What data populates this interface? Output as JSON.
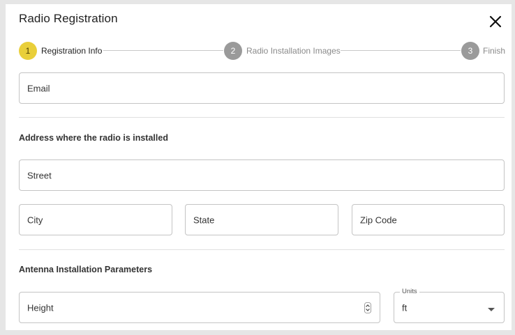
{
  "dialog": {
    "title": "Radio Registration",
    "close_icon": "close-icon"
  },
  "stepper": {
    "steps": [
      {
        "number": "1",
        "label": "Registration Info",
        "state": "active"
      },
      {
        "number": "2",
        "label": "Radio Installation Images",
        "state": "inactive"
      },
      {
        "number": "3",
        "label": "Finish",
        "state": "inactive"
      }
    ],
    "active_color": "#e9cf3a",
    "inactive_color": "#9a9a9a"
  },
  "form": {
    "email_placeholder": "Email",
    "address_section_title": "Address where the radio is installed",
    "street_placeholder": "Street",
    "city_placeholder": "City",
    "state_placeholder": "State",
    "zip_placeholder": "Zip Code",
    "antenna_section_title": "Antenna Installation Parameters",
    "height_placeholder": "Height",
    "units_label": "Units",
    "units_value": "ft"
  }
}
